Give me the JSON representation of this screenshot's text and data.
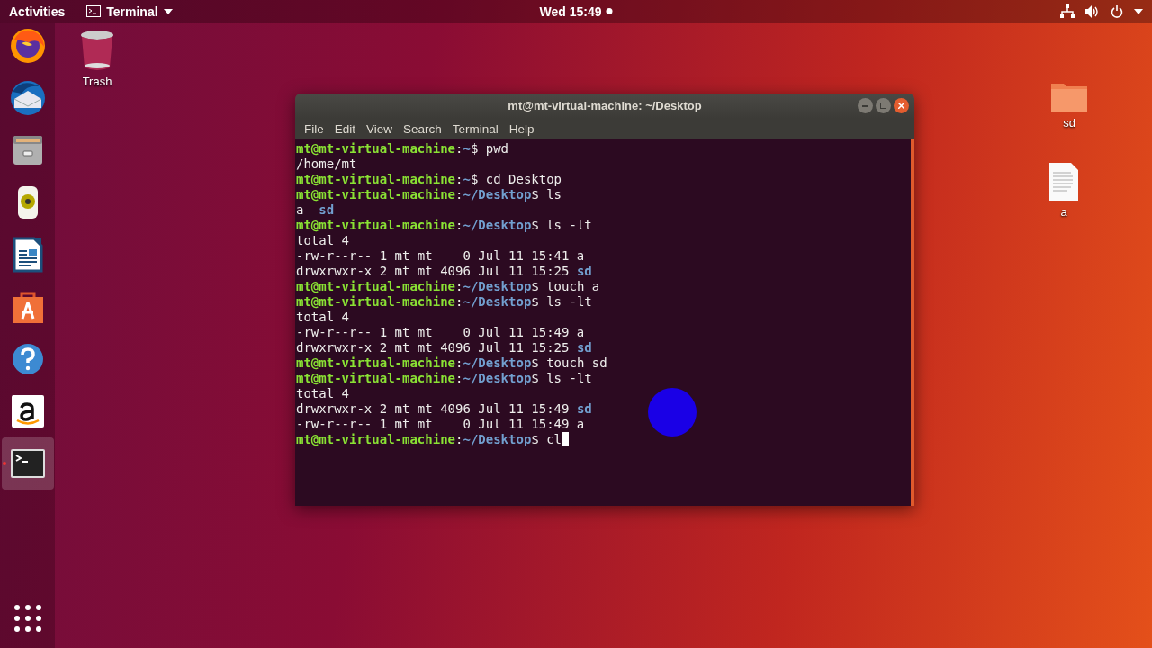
{
  "top_bar": {
    "activities": "Activities",
    "app_menu": "Terminal",
    "clock": "Wed 15:49",
    "notification": true
  },
  "dock": {
    "items": [
      {
        "kind": "firefox",
        "running": false,
        "selected": false
      },
      {
        "kind": "thunderbird",
        "running": false,
        "selected": false
      },
      {
        "kind": "files",
        "running": false,
        "selected": false
      },
      {
        "kind": "rhythmbox",
        "running": false,
        "selected": false
      },
      {
        "kind": "writer",
        "running": false,
        "selected": false
      },
      {
        "kind": "software",
        "running": false,
        "selected": false
      },
      {
        "kind": "help",
        "running": false,
        "selected": false
      },
      {
        "kind": "amazon",
        "running": false,
        "selected": false
      },
      {
        "kind": "terminal",
        "running": true,
        "selected": true
      }
    ]
  },
  "desktop_icons": [
    {
      "kind": "trash",
      "label": "Trash"
    },
    {
      "kind": "folder",
      "label": "sd"
    },
    {
      "kind": "document",
      "label": "a"
    }
  ],
  "window": {
    "title": "mt@mt-virtual-machine: ~/Desktop",
    "menu": [
      "File",
      "Edit",
      "View",
      "Search",
      "Terminal",
      "Help"
    ],
    "lines": [
      [
        {
          "kind": "user",
          "text": "mt@mt-virtual-machine"
        },
        {
          "kind": "plain",
          "text": ":"
        },
        {
          "kind": "path",
          "text": "~"
        },
        {
          "kind": "plain",
          "text": "$ pwd"
        }
      ],
      [
        {
          "kind": "plain",
          "text": "/home/mt"
        }
      ],
      [
        {
          "kind": "user",
          "text": "mt@mt-virtual-machine"
        },
        {
          "kind": "plain",
          "text": ":"
        },
        {
          "kind": "path",
          "text": "~"
        },
        {
          "kind": "plain",
          "text": "$ cd Desktop"
        }
      ],
      [
        {
          "kind": "user",
          "text": "mt@mt-virtual-machine"
        },
        {
          "kind": "plain",
          "text": ":"
        },
        {
          "kind": "path",
          "text": "~/Desktop"
        },
        {
          "kind": "plain",
          "text": "$ ls"
        }
      ],
      [
        {
          "kind": "plain",
          "text": "a  "
        },
        {
          "kind": "dir",
          "text": "sd"
        }
      ],
      [
        {
          "kind": "user",
          "text": "mt@mt-virtual-machine"
        },
        {
          "kind": "plain",
          "text": ":"
        },
        {
          "kind": "path",
          "text": "~/Desktop"
        },
        {
          "kind": "plain",
          "text": "$ ls -lt"
        }
      ],
      [
        {
          "kind": "plain",
          "text": "total 4"
        }
      ],
      [
        {
          "kind": "plain",
          "text": "-rw-r--r-- 1 mt mt    0 Jul 11 15:41 a"
        }
      ],
      [
        {
          "kind": "plain",
          "text": "drwxrwxr-x 2 mt mt 4096 Jul 11 15:25 "
        },
        {
          "kind": "dir",
          "text": "sd"
        }
      ],
      [
        {
          "kind": "user",
          "text": "mt@mt-virtual-machine"
        },
        {
          "kind": "plain",
          "text": ":"
        },
        {
          "kind": "path",
          "text": "~/Desktop"
        },
        {
          "kind": "plain",
          "text": "$ touch a"
        }
      ],
      [
        {
          "kind": "user",
          "text": "mt@mt-virtual-machine"
        },
        {
          "kind": "plain",
          "text": ":"
        },
        {
          "kind": "path",
          "text": "~/Desktop"
        },
        {
          "kind": "plain",
          "text": "$ ls -lt"
        }
      ],
      [
        {
          "kind": "plain",
          "text": "total 4"
        }
      ],
      [
        {
          "kind": "plain",
          "text": "-rw-r--r-- 1 mt mt    0 Jul 11 15:49 a"
        }
      ],
      [
        {
          "kind": "plain",
          "text": "drwxrwxr-x 2 mt mt 4096 Jul 11 15:25 "
        },
        {
          "kind": "dir",
          "text": "sd"
        }
      ],
      [
        {
          "kind": "user",
          "text": "mt@mt-virtual-machine"
        },
        {
          "kind": "plain",
          "text": ":"
        },
        {
          "kind": "path",
          "text": "~/Desktop"
        },
        {
          "kind": "plain",
          "text": "$ touch sd"
        }
      ],
      [
        {
          "kind": "user",
          "text": "mt@mt-virtual-machine"
        },
        {
          "kind": "plain",
          "text": ":"
        },
        {
          "kind": "path",
          "text": "~/Desktop"
        },
        {
          "kind": "plain",
          "text": "$ ls -lt"
        }
      ],
      [
        {
          "kind": "plain",
          "text": "total 4"
        }
      ],
      [
        {
          "kind": "plain",
          "text": "drwxrwxr-x 2 mt mt 4096 Jul 11 15:49 "
        },
        {
          "kind": "dir",
          "text": "sd"
        }
      ],
      [
        {
          "kind": "plain",
          "text": "-rw-r--r-- 1 mt mt    0 Jul 11 15:49 a"
        }
      ],
      [
        {
          "kind": "user",
          "text": "mt@mt-virtual-machine"
        },
        {
          "kind": "plain",
          "text": ":"
        },
        {
          "kind": "path",
          "text": "~/Desktop"
        },
        {
          "kind": "plain",
          "text": "$ cl"
        }
      ]
    ],
    "cursor": true
  }
}
